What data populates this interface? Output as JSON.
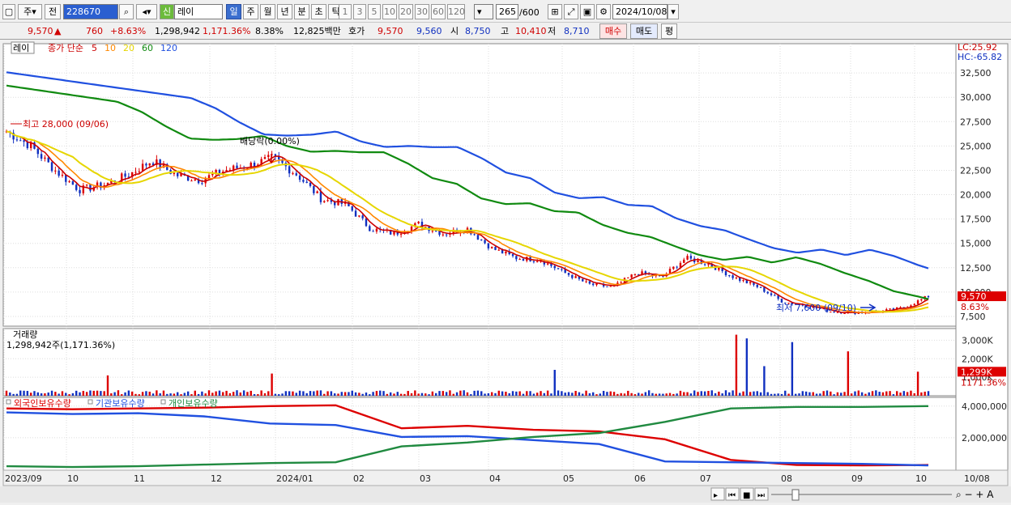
{
  "toolbar": {
    "type_select": "주",
    "prev_label": "전",
    "code": "228670",
    "badge": "신",
    "name": "레이",
    "periods": [
      "일",
      "주",
      "월",
      "년",
      "분",
      "초",
      "틱"
    ],
    "selected_period": "일",
    "intervals": [
      "1",
      "3",
      "5",
      "10",
      "20",
      "30",
      "60",
      "120"
    ],
    "count": "265",
    "count_max": "/600",
    "date": "2024/10/08"
  },
  "quote": {
    "price": "9,570",
    "arrow": "▲",
    "change": "760",
    "change_pct": "+8.63%",
    "volume": "1,298,942",
    "volume_pct": "1,171.36%",
    "turnover_pct": "8.38%",
    "amount": "12,825백만",
    "hoga_label": "호가",
    "ask": "9,570",
    "bid": "9,560",
    "open_label": "시",
    "open": "8,750",
    "high_label": "고",
    "high": "10,410",
    "low_label": "저",
    "low": "8,710",
    "buy_button": "매수",
    "sell_button": "매도",
    "eval_button": "평"
  },
  "price_panel": {
    "legend_name": "레이",
    "legend_main": "종가 단순",
    "ma_periods": [
      "5",
      "10",
      "20",
      "60",
      "120"
    ],
    "ma_colors": [
      "#cc0000",
      "#ff8800",
      "#e6d600",
      "#108a10",
      "#2050e0"
    ],
    "lc": "LC:25.92",
    "hc": "HC:-65.82",
    "high_annotation": "최고 28,000 (09/06)",
    "low_annotation": "최저 7,600 (09/10)",
    "dividend_annotation": "배당락(0.00%)",
    "current_tag": "9,570",
    "current_pct": "8.63%",
    "y_ticks": [
      "32,500",
      "30,000",
      "27,500",
      "25,000",
      "22,500",
      "20,000",
      "17,500",
      "15,000",
      "12,500",
      "10,000",
      "7,500"
    ]
  },
  "volume_panel": {
    "title": "거래량",
    "value": "1,298,942주(1,171.36%)",
    "y_ticks": [
      "3,000K",
      "2,000K",
      "1,000K"
    ],
    "current_tag": "1,299K",
    "current_pct": "1171.36%"
  },
  "holding_panel": {
    "legend": [
      "외국인보유수량",
      "기관보유수량",
      "개인보유수량"
    ],
    "colors": [
      "#dd0000",
      "#2050e0",
      "#208a40"
    ],
    "y_ticks": [
      "4,000,000",
      "2,000,000"
    ]
  },
  "x_axis": {
    "labels": [
      "2023/09",
      "10",
      "11",
      "12",
      "2024/01",
      "02",
      "03",
      "04",
      "05",
      "06",
      "07",
      "08",
      "09",
      "10"
    ],
    "right_label": "10/08"
  },
  "chart_data": [
    {
      "type": "line",
      "name": "price",
      "x": [
        "2023/09",
        "10",
        "11",
        "12",
        "2024/01",
        "02",
        "03",
        "04",
        "05",
        "06",
        "07",
        "08",
        "09",
        "10"
      ],
      "close_series": [
        26500,
        25000,
        22500,
        20500,
        21000,
        22000,
        23500,
        22000,
        21500,
        22500,
        23000,
        23800,
        22000,
        19500,
        19000,
        16500,
        16000,
        17000,
        16000,
        16500,
        14500,
        13500,
        13300,
        12000,
        10800,
        10500,
        12000,
        11500,
        13500,
        12800,
        11500,
        10500,
        9000,
        8600,
        8000,
        7900,
        8000,
        8400,
        9570
      ],
      "series": [
        {
          "name": "5",
          "values_hint": "short moving average"
        },
        {
          "name": "10",
          "values_hint": "moving average"
        },
        {
          "name": "20",
          "values_hint": "moving average"
        },
        {
          "name": "60",
          "start": 34500,
          "end": 9500
        },
        {
          "name": "120",
          "start": 34800,
          "end": 10800
        }
      ],
      "ylim": [
        6500,
        35500
      ],
      "high": 28000,
      "low": 7600
    },
    {
      "type": "bar",
      "name": "volume",
      "ylim": [
        0,
        3500000
      ],
      "last_value": 1298942
    },
    {
      "type": "line",
      "name": "holdings",
      "series": [
        {
          "name": "외국인보유수량",
          "values": [
            3850000,
            3800000,
            3850000,
            3900000,
            4000000,
            4050000,
            2600000,
            2750000,
            2500000,
            2400000,
            1900000,
            600000,
            280000,
            250000,
            280000
          ]
        },
        {
          "name": "기관보유수량",
          "values": [
            3600000,
            3500000,
            3550000,
            3350000,
            2900000,
            2800000,
            2050000,
            2100000,
            1850000,
            1600000,
            500000,
            450000,
            400000,
            350000,
            250000
          ]
        },
        {
          "name": "개인보유수량",
          "values": [
            200000,
            150000,
            200000,
            300000,
            400000,
            450000,
            1450000,
            1700000,
            2050000,
            2300000,
            3000000,
            3850000,
            3950000,
            3950000,
            4000000
          ]
        }
      ],
      "ylim": [
        0,
        4500000
      ]
    }
  ]
}
